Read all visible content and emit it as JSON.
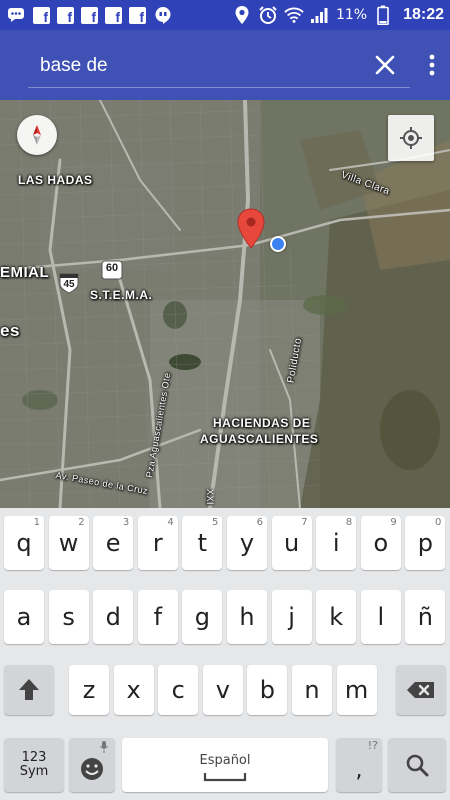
{
  "status_bar": {
    "battery": "11%",
    "time": "18:22",
    "notification_icons": [
      "message-icon",
      "facebook-icon",
      "facebook-icon",
      "facebook-icon",
      "facebook-icon",
      "facebook-icon",
      "hangouts-icon",
      "location-icon",
      "alarm-icon",
      "wifi-icon",
      "signal-icon",
      "battery-icon"
    ]
  },
  "search": {
    "value": "base de",
    "clear_icon": "close-icon",
    "menu_icon": "more-vert-icon"
  },
  "map": {
    "type": "satellite",
    "labels": {
      "las_hadas": "LAS HADAS",
      "emial": "EMIAL",
      "es": "es",
      "stema": "S.T.E.M.A.",
      "haciendas_1": "HACIENDAS DE",
      "haciendas_2": "AGUASCALIENTES",
      "villa_clara": "Villa Clara",
      "poliducto": "Poliducto",
      "av_aguascalientes": "Pza Aguascalientes Ote",
      "paseo": "Av. Paseo de la Cruz",
      "xxi": "XXI"
    },
    "shields": {
      "route_60": "60",
      "route_45": "45"
    },
    "marker_color": "#e8473b",
    "my_location_color": "#3b82f0"
  },
  "keyboard": {
    "row1": [
      {
        "k": "q",
        "h": "1"
      },
      {
        "k": "w",
        "h": "2"
      },
      {
        "k": "e",
        "h": "3"
      },
      {
        "k": "r",
        "h": "4"
      },
      {
        "k": "t",
        "h": "5"
      },
      {
        "k": "y",
        "h": "6"
      },
      {
        "k": "u",
        "h": "7"
      },
      {
        "k": "i",
        "h": "8"
      },
      {
        "k": "o",
        "h": "9"
      },
      {
        "k": "p",
        "h": "0"
      }
    ],
    "row2": [
      "a",
      "s",
      "d",
      "f",
      "g",
      "h",
      "j",
      "k",
      "l",
      "ñ"
    ],
    "row3": [
      "z",
      "x",
      "c",
      "v",
      "b",
      "n",
      "m"
    ],
    "sym_line1": "123",
    "sym_line2": "Sym",
    "space_label": "Español",
    "punct_hint": "!?",
    "punct_key": ",",
    "shift_icon": "shift-icon",
    "backspace_icon": "backspace-icon",
    "emoji_icon": "emoji-icon",
    "mic_icon": "mic-icon",
    "search_icon": "search-icon"
  }
}
